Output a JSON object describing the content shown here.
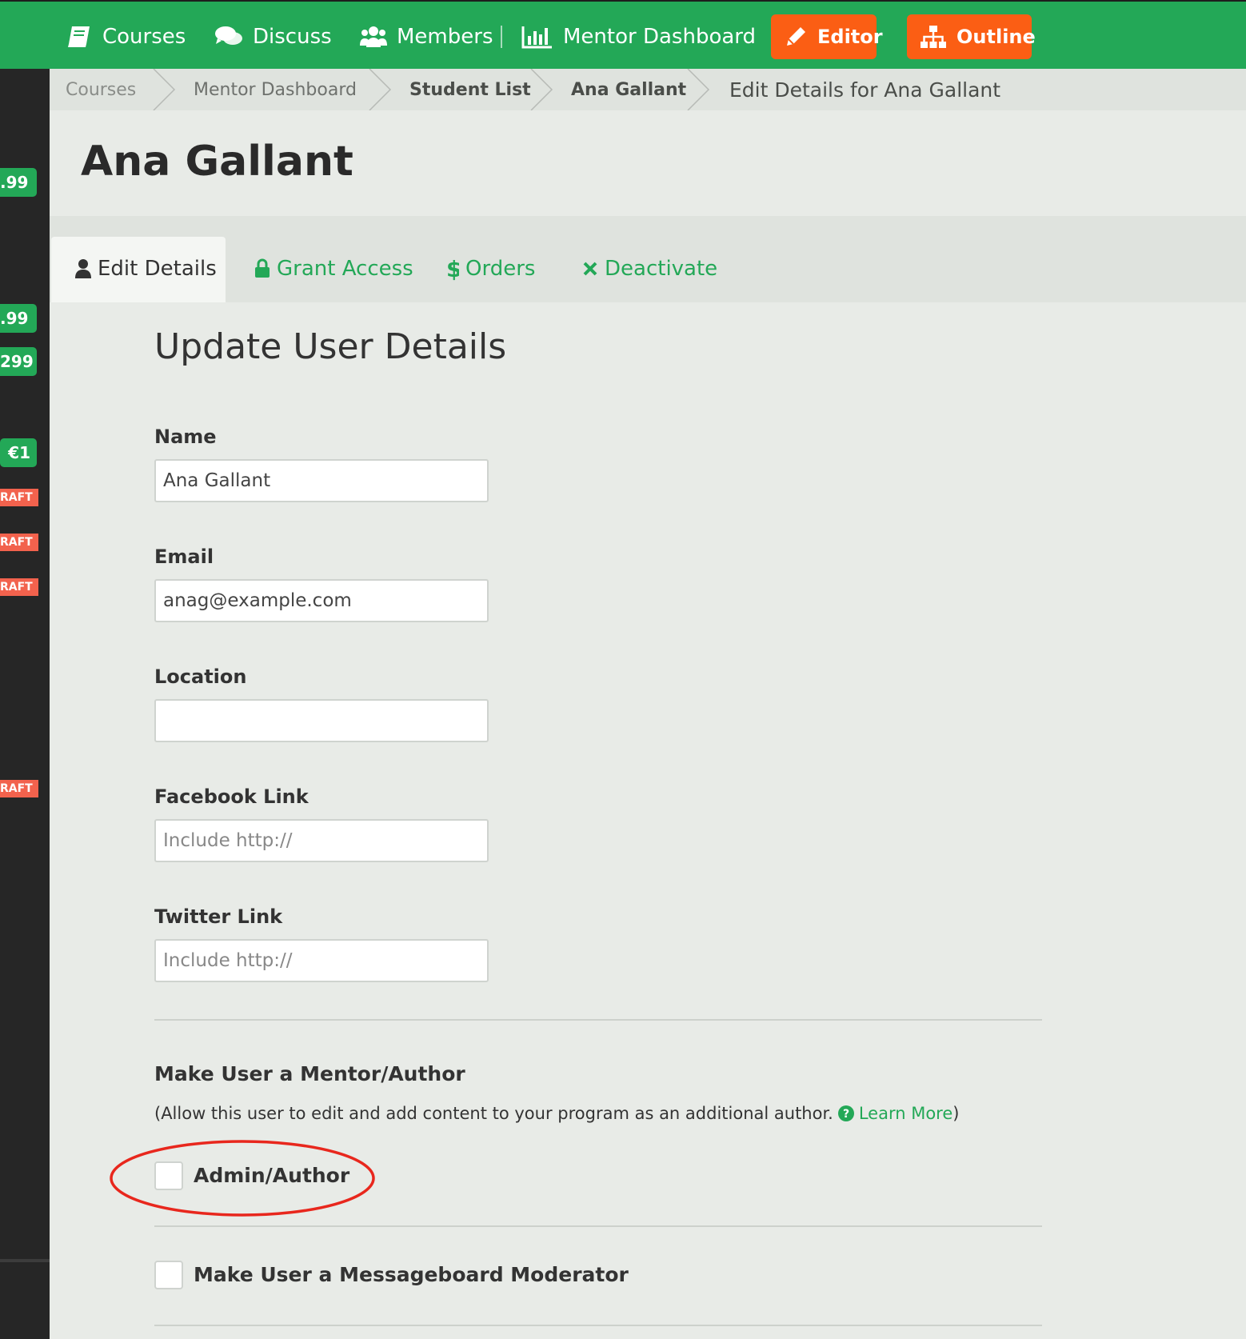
{
  "nav": {
    "courses": "Courses",
    "discuss": "Discuss",
    "members": "Members",
    "mentor_dashboard": "Mentor Dashboard",
    "editor": "Editor",
    "outline": "Outline",
    "accent": "#23a857",
    "button_color": "#fb5e14"
  },
  "sidebar": {
    "prices": [
      ".99",
      ".99",
      "299",
      "€1"
    ],
    "draft": "RAFT"
  },
  "breadcrumb": {
    "items": [
      "Courses",
      "Mentor Dashboard",
      "Student List",
      "Ana Gallant"
    ],
    "current": "Edit Details for Ana Gallant"
  },
  "page": {
    "title": "Ana Gallant"
  },
  "tabs": {
    "edit_details": "Edit Details",
    "grant_access": "Grant Access",
    "orders": "Orders",
    "deactivate": "Deactivate"
  },
  "form": {
    "section_title": "Update User Details",
    "name_label": "Name",
    "name_value": "Ana Gallant",
    "email_label": "Email",
    "email_value": "anag@example.com",
    "location_label": "Location",
    "location_value": "",
    "facebook_label": "Facebook Link",
    "facebook_placeholder": "Include http://",
    "twitter_label": "Twitter Link",
    "twitter_placeholder": "Include http://"
  },
  "mentor": {
    "title": "Make User a Mentor/Author",
    "description": "(Allow this user to edit and add content to your program as an additional author.",
    "learn_more": "Learn More",
    "close_paren": ")",
    "admin_label": "Admin/Author",
    "admin_checked": false,
    "moderator_label": "Make User a Messageboard Moderator",
    "moderator_checked": false,
    "annotation_color": "#e8271d"
  }
}
